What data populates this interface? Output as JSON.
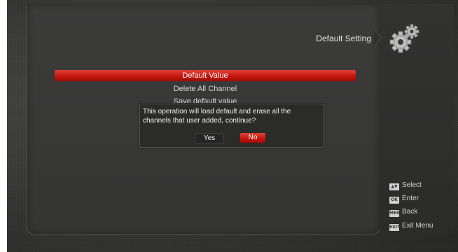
{
  "header": {
    "title": "Default Setting",
    "icon": "gear-icon"
  },
  "menu": {
    "items": [
      {
        "label": "Default Value",
        "selected": true
      },
      {
        "label": "Delete All Channel",
        "selected": false
      },
      {
        "label": "Save default value",
        "selected": false
      }
    ]
  },
  "dialog": {
    "message": "This operation will load default and erase all the channels that user added, continue?",
    "yes_label": "Yes",
    "no_label": "No",
    "focused": "No"
  },
  "hints": [
    {
      "key": "▲▼",
      "key_icon": "arrow-keys-icon",
      "label": "Select"
    },
    {
      "key": "OK",
      "key_icon": "ok-key-icon",
      "label": "Enter"
    },
    {
      "key": "MENU",
      "key_icon": "menu-key-icon",
      "label": "Back"
    },
    {
      "key": "EXIT",
      "key_icon": "exit-key-icon",
      "label": "Exit Menu"
    }
  ],
  "colors": {
    "accent_red": "#c5160e",
    "background": "#353534",
    "text": "#e6e6e6"
  }
}
